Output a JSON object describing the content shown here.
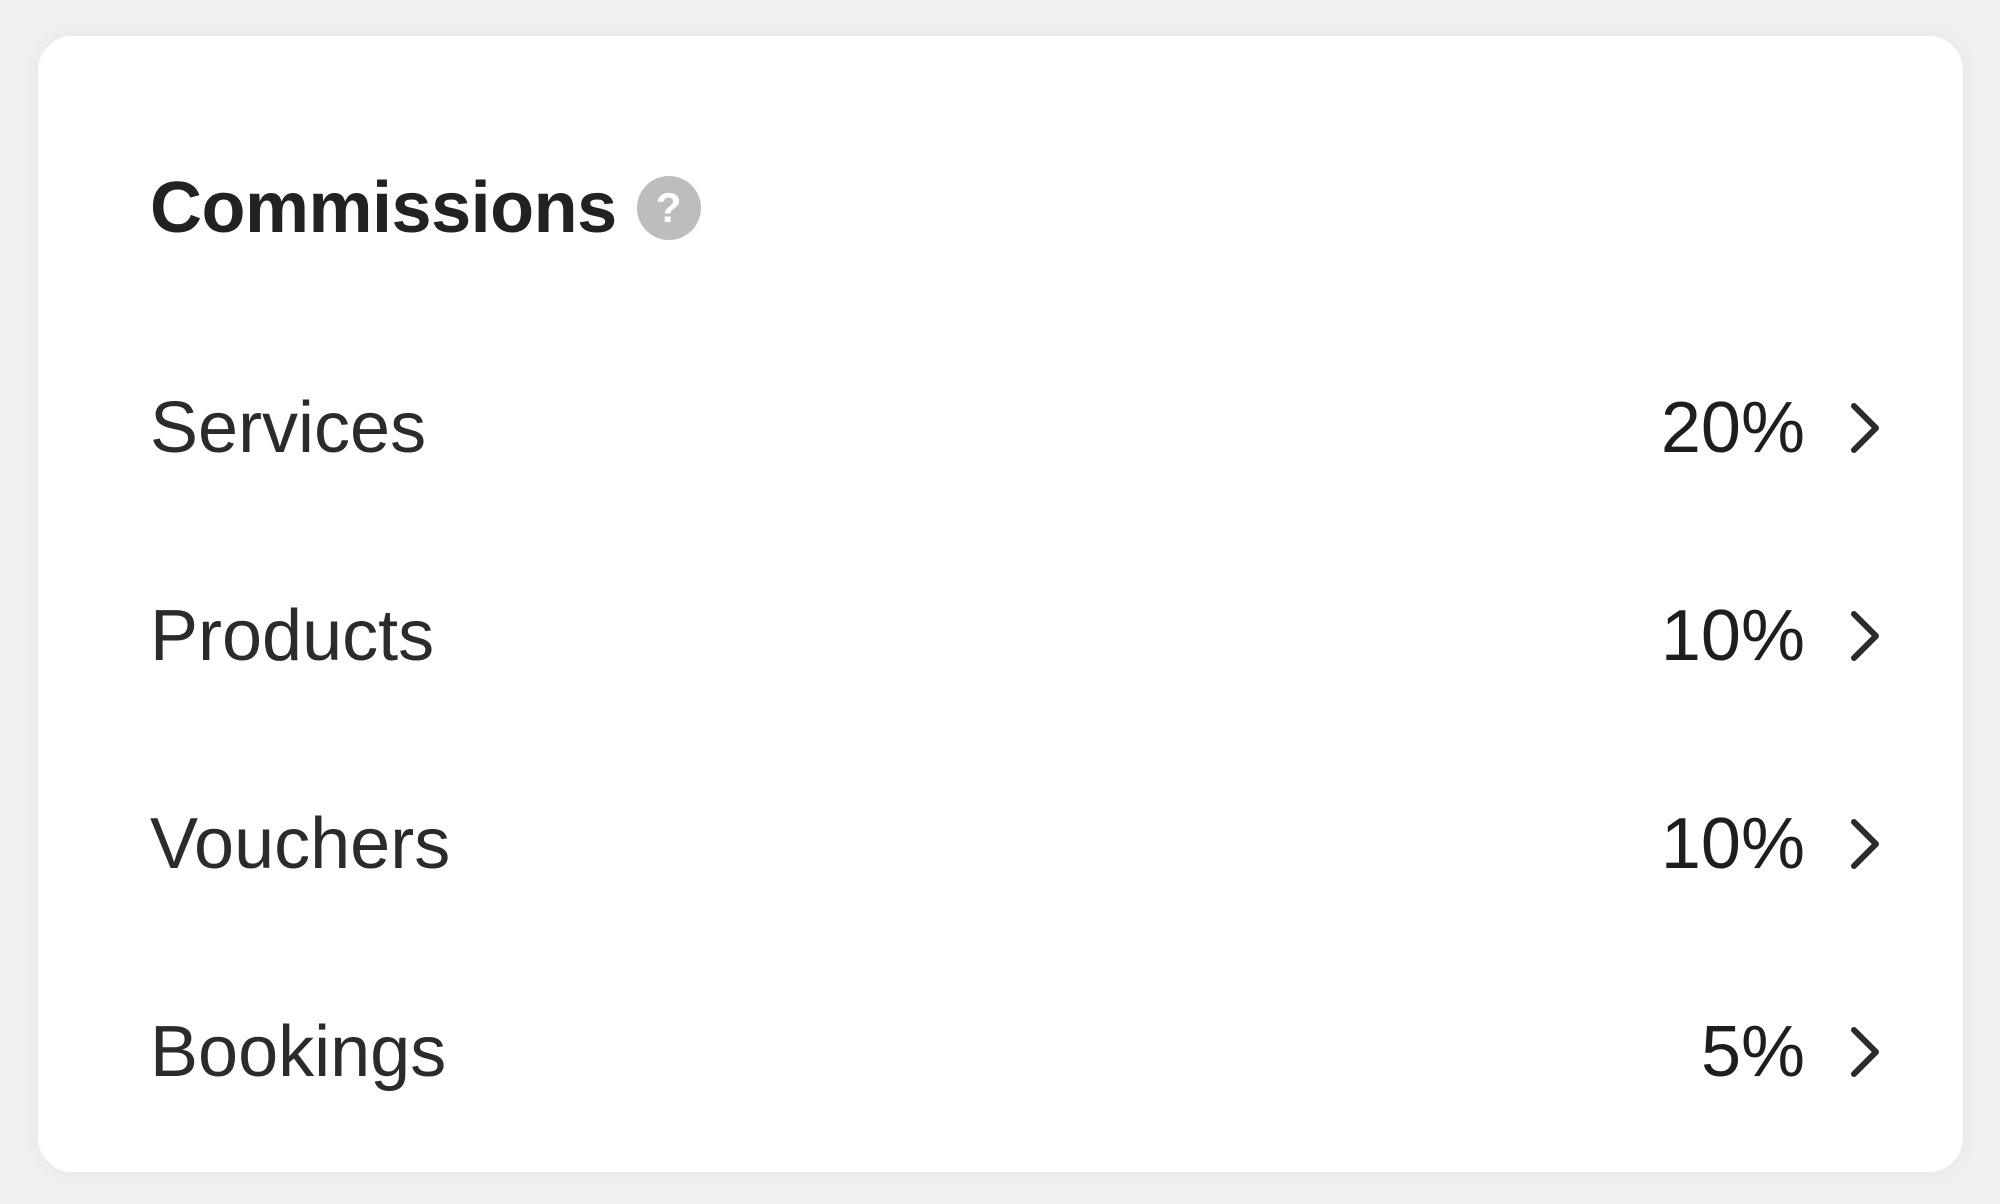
{
  "card": {
    "title": "Commissions",
    "help_icon_glyph": "?",
    "help_icon_name": "question-mark-icon",
    "rows": [
      {
        "label": "Services",
        "value": "20%",
        "icon": "chevron-right-icon"
      },
      {
        "label": "Products",
        "value": "10%",
        "icon": "chevron-right-icon"
      },
      {
        "label": "Vouchers",
        "value": "10%",
        "icon": "chevron-right-icon"
      },
      {
        "label": "Bookings",
        "value": "5%",
        "icon": "chevron-right-icon"
      }
    ]
  },
  "colors": {
    "background": "#f0f0f0",
    "card": "#ffffff",
    "text": "#222222",
    "help_icon": "#bdbdbd"
  }
}
